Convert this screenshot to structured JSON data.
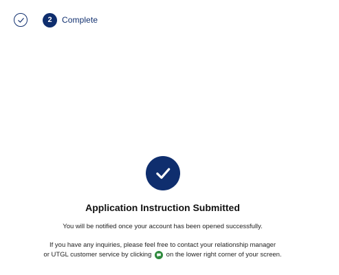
{
  "stepper": {
    "step1": {
      "status": "completed",
      "icon": "check-icon"
    },
    "step2": {
      "number": "2",
      "label": "Complete",
      "status": "active"
    }
  },
  "colors": {
    "primary": "#0f2e6e",
    "chat_icon": "#2f8a3d"
  },
  "confirmation": {
    "icon": "checkmark-circle-icon",
    "title": "Application Instruction Submitted",
    "subtitle": "You will be notified once your account has been opened successfully.",
    "info_line1": "If you have any inquiries, please feel free to contact your relationship manager",
    "info_line2_before": "or UTGL customer service by clicking",
    "info_line2_after": "on the lower right corner of your screen.",
    "chat_icon": "chat-icon"
  }
}
